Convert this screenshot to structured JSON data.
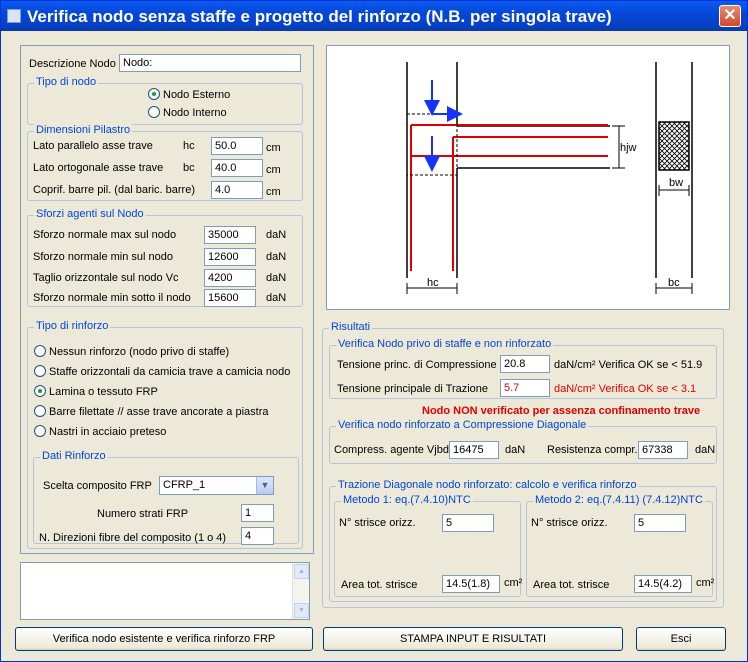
{
  "window": {
    "title": "Verifica nodo senza staffe e progetto del rinforzo (N.B.  per singola  trave)",
    "close_glyph": "✕"
  },
  "left": {
    "descrizione": {
      "label": "Descrizione Nodo",
      "value": "Nodo:"
    },
    "tipo_nodo": {
      "title": "Tipo di nodo",
      "options": [
        {
          "label": "Nodo Esterno",
          "selected": true
        },
        {
          "label": "Nodo Interno",
          "selected": false
        }
      ]
    },
    "dimensioni": {
      "title": "Dimensioni Pilastro",
      "rows": [
        {
          "label": "Lato  parallelo asse trave",
          "symbol": "hc",
          "value": "50.0",
          "unit": "cm"
        },
        {
          "label": "Lato  ortogonale asse trave",
          "symbol": "bc",
          "value": "40.0",
          "unit": "cm"
        },
        {
          "label": "Coprif. barre pil. (dal baric. barre)",
          "symbol": "",
          "value": "4.0",
          "unit": "cm"
        }
      ]
    },
    "sforzi": {
      "title": "Sforzi agenti sul Nodo",
      "rows": [
        {
          "label": "Sforzo normale max sul nodo",
          "value": "35000",
          "unit": "daN"
        },
        {
          "label": "Sforzo normale min sul nodo",
          "value": "12600",
          "unit": "daN"
        },
        {
          "label": "Taglio orizzontale sul nodo Vc",
          "value": "4200",
          "unit": "daN"
        },
        {
          "label": "Sforzo normale min sotto il nodo",
          "value": "15600",
          "unit": "daN"
        }
      ]
    },
    "rinforzo": {
      "title": "Tipo di rinforzo",
      "options": [
        {
          "label": "Nessun rinforzo (nodo privo di staffe)",
          "selected": false
        },
        {
          "label": "Staffe orizzontali  da camicia trave a camicia nodo",
          "selected": false
        },
        {
          "label": "Lamina o tessuto FRP",
          "selected": true
        },
        {
          "label": "Barre filettate // asse trave ancorate a piastra",
          "selected": false
        },
        {
          "label": "Nastri in acciaio preteso",
          "selected": false
        }
      ],
      "dati": {
        "title": "Dati  Rinforzo",
        "composito_label": "Scelta composito FRP",
        "composito_value": "CFRP_1",
        "strati_label": "Numero strati FRP",
        "strati_value": "1",
        "direzioni_label": "N. Direzioni fibre del composito (1 o 4)",
        "direzioni_value": "4"
      }
    }
  },
  "diagram": {
    "hjw": "hjw",
    "bw": "bw",
    "hc": "hc",
    "bc": "bc"
  },
  "risultati": {
    "title": "Risultati",
    "verifica": {
      "title": "Verifica Nodo privo di staffe e non rinforzato",
      "compressione_label": "Tensione princ. di Compressione",
      "compressione_value": "20.8",
      "compressione_note": "daN/cm² Verifica OK se < 51.9",
      "trazione_label": "Tensione  principale di Trazione",
      "trazione_value": "5.7",
      "trazione_note": "daN/cm²  Verifica OK se < 3.1"
    },
    "warning": "Nodo NON verificato per assenza confinamento trave",
    "compressione_diag": {
      "title": "Verifica  nodo rinforzato a Compressione Diagonale",
      "agente_label": "Compress. agente Vjbd",
      "agente_value": "16475",
      "agente_unit": "daN",
      "resistenza_label": "Resistenza compr.",
      "resistenza_value": "67338",
      "resistenza_unit": "daN"
    },
    "trazione_diag": {
      "title": "Trazione Diagonale nodo rinforzato: calcolo e verifica rinforzo",
      "metodo1": {
        "title": "Metodo 1: eq.(7.4.10)NTC",
        "strisce_label": "N° strisce orizz.",
        "strisce_value": "5",
        "area_label": "Area tot. strisce",
        "area_value": "14.5(1.8)",
        "area_unit": "cm²"
      },
      "metodo2": {
        "title": "Metodo 2: eq.(7.4.11) (7.4.12)NTC",
        "strisce_label": "N° strisce orizz.",
        "strisce_value": "5",
        "area_label": "Area tot. strisce",
        "area_value": "14.5(4.2)",
        "area_unit": "cm²"
      }
    }
  },
  "buttons": {
    "verifica": "Verifica nodo esistente e verifica rinforzo FRP",
    "stampa": "STAMPA  INPUT  E  RISULTATI",
    "esci": "Esci"
  }
}
